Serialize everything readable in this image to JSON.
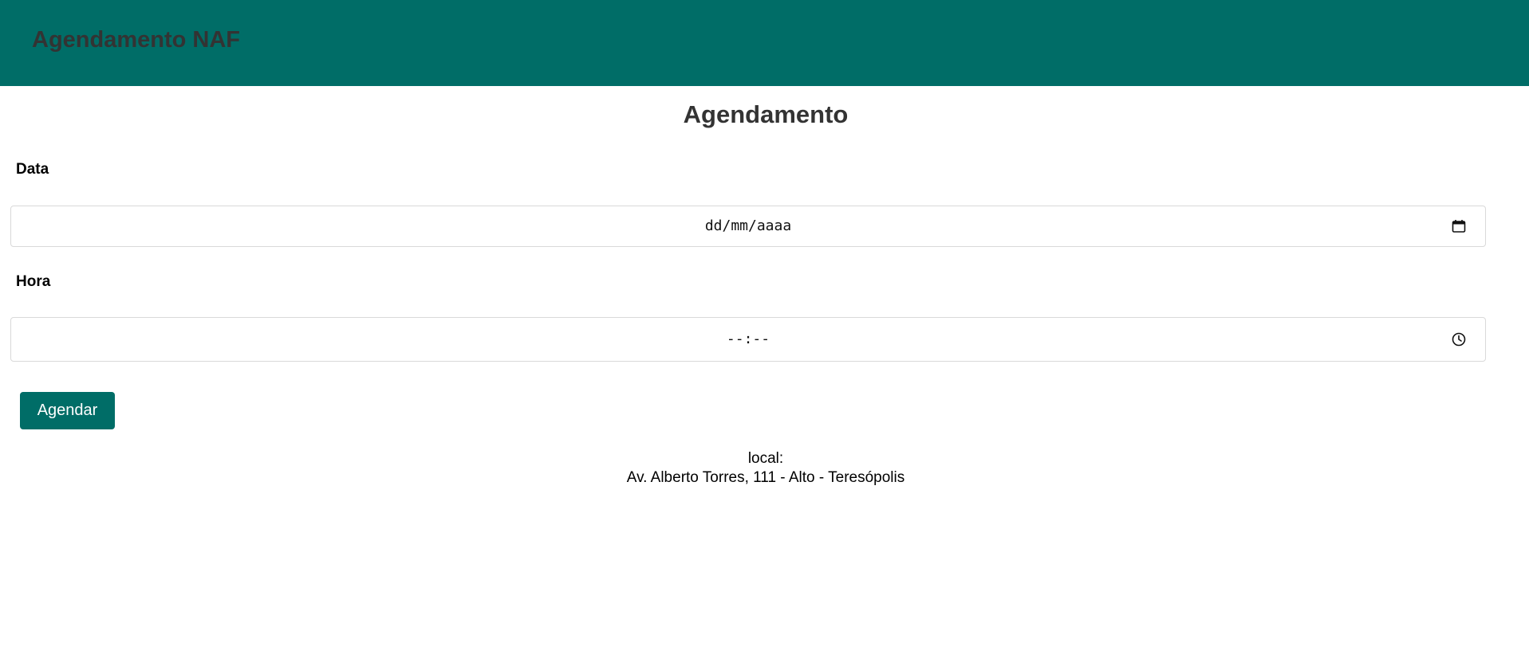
{
  "header": {
    "brand": "Agendamento NAF",
    "background_color": "#006d67"
  },
  "main": {
    "title": "Agendamento",
    "date_field": {
      "label": "Data",
      "placeholder": "dd/mm/aaaa",
      "icon": "calendar-icon"
    },
    "time_field": {
      "label": "Hora",
      "placeholder": "--:--",
      "icon": "clock-icon"
    },
    "submit_label": "Agendar",
    "accent_color": "#006d67"
  },
  "location": {
    "label": "local:",
    "address": "Av. Alberto Torres, 111 - Alto - Teresópolis"
  }
}
